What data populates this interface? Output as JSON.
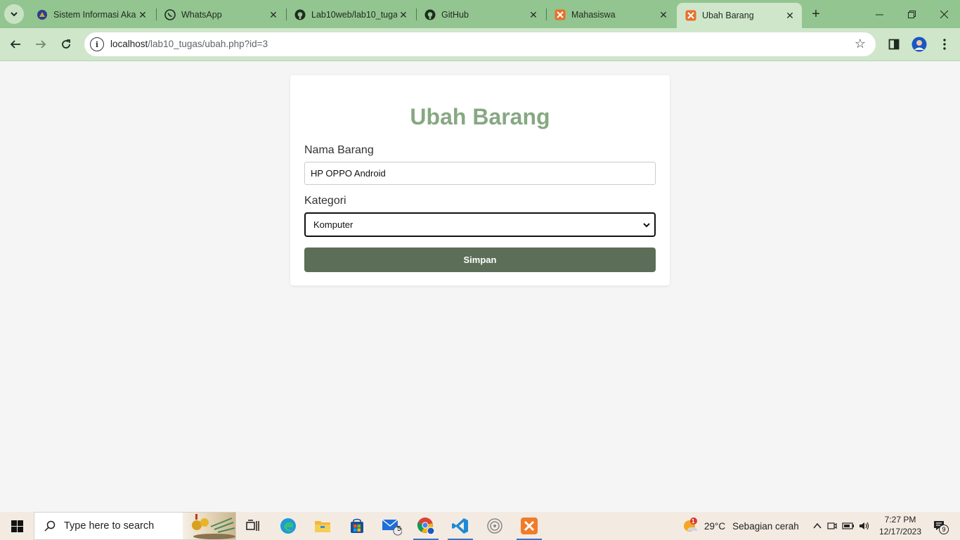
{
  "browser": {
    "tabs": [
      {
        "title": "Sistem Informasi Akad",
        "favicon": "university-icon"
      },
      {
        "title": "WhatsApp",
        "favicon": "whatsapp-icon"
      },
      {
        "title": "Lab10web/lab10_tuga",
        "favicon": "github-icon"
      },
      {
        "title": "GitHub",
        "favicon": "github-icon"
      },
      {
        "title": "Mahasiswa",
        "favicon": "xampp-icon"
      },
      {
        "title": "Ubah Barang",
        "favicon": "xampp-icon",
        "active": true
      }
    ],
    "url_host": "localhost",
    "url_path": "/lab10_tugas/ubah.php?id=3"
  },
  "page": {
    "title": "Ubah Barang",
    "nama_label": "Nama Barang",
    "nama_value": "HP OPPO Android",
    "kategori_label": "Kategori",
    "kategori_selected": "Komputer",
    "submit_label": "Simpan"
  },
  "taskbar": {
    "search_placeholder": "Type here to search",
    "mail_badge": "5",
    "weather_badge": "1",
    "temperature": "29°C",
    "weather_text": "Sebagian cerah",
    "time": "7:27 PM",
    "date": "12/17/2023",
    "notification_count": "9"
  },
  "colors": {
    "tabbar": "#93c590",
    "toolbar": "#cfe6cb",
    "heading": "#86a882",
    "button": "#5c6e57"
  }
}
